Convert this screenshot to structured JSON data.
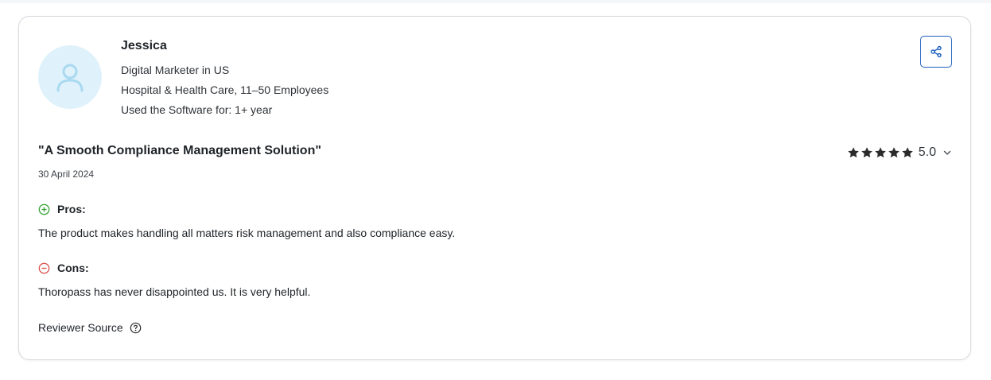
{
  "reviewer": {
    "name": "Jessica",
    "role": "Digital Marketer in US",
    "company": "Hospital & Health Care, 11–50 Employees",
    "usage": "Used the Software for: 1+ year"
  },
  "review": {
    "title": "\"A Smooth Compliance Management Solution\"",
    "date": "30 April 2024",
    "rating": 5.0,
    "rating_label": "5.0",
    "pros_label": "Pros:",
    "pros_text": "The product makes handling all matters risk management and also compliance easy.",
    "cons_label": "Cons:",
    "cons_text": "Thoropass has never disappointed us. It is very helpful."
  },
  "footer": {
    "source_label": "Reviewer Source"
  },
  "icons": {
    "avatar": "user-icon",
    "share": "share-icon",
    "star": "star-icon",
    "expand": "chevron-down-icon",
    "pros": "plus-circle-icon",
    "cons": "minus-circle-icon",
    "help": "question-circle-icon"
  },
  "colors": {
    "share_accent": "#1d5fbf",
    "pros_green": "#3aa63a",
    "cons_red": "#d9534f",
    "avatar_bg": "#dff2fb",
    "avatar_fg": "#a9d9f0"
  }
}
